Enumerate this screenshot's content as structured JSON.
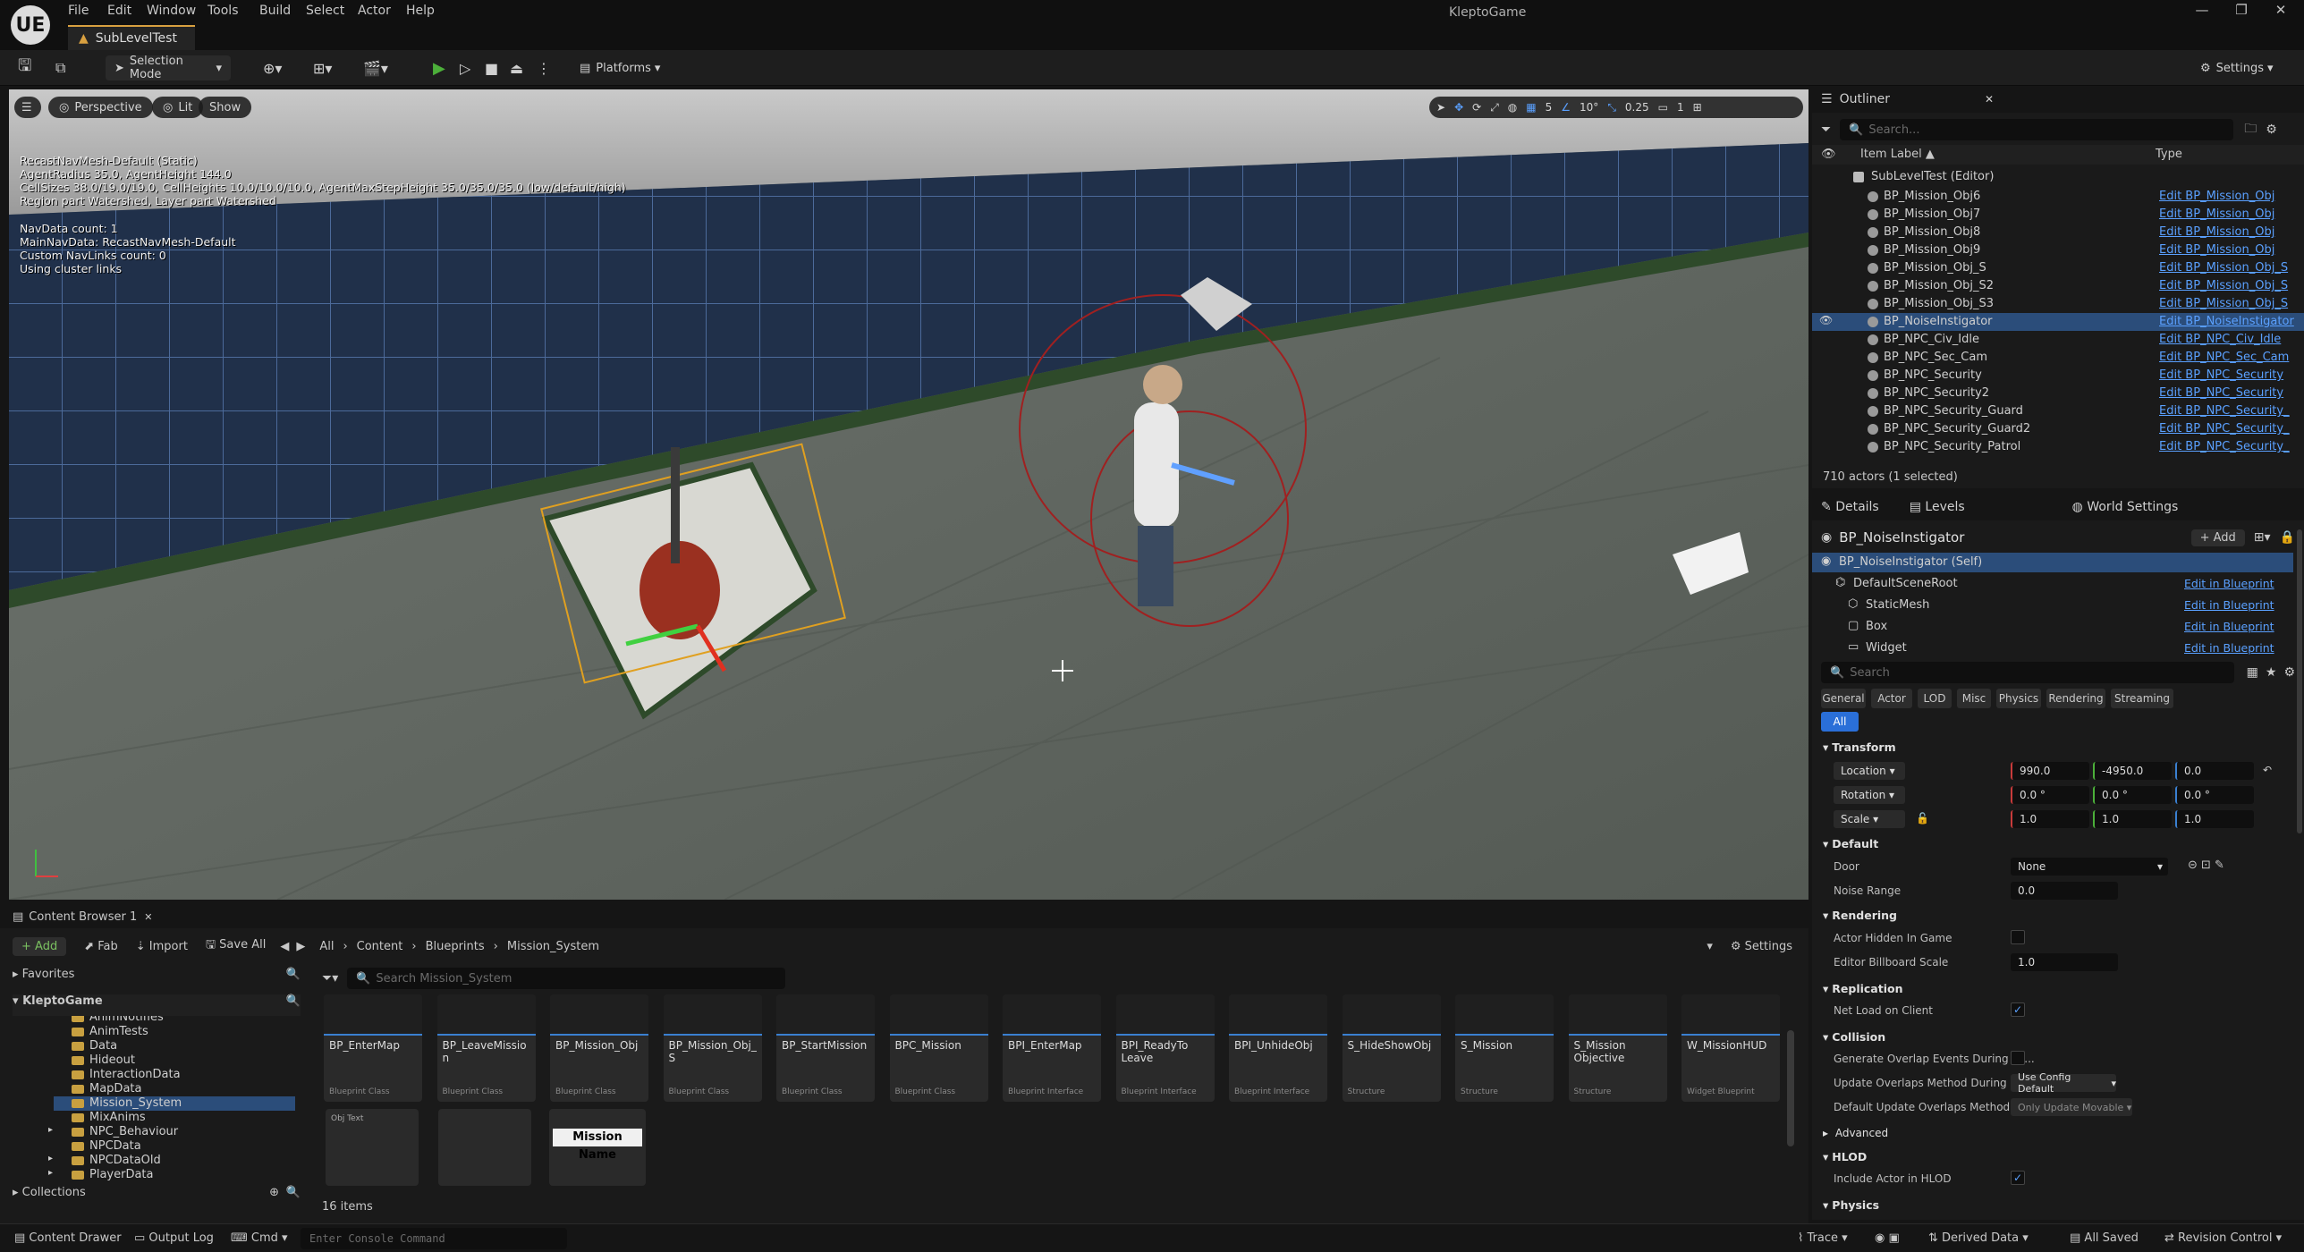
{
  "app": {
    "project": "KleptoGame",
    "tab": "SubLevelTest",
    "logo": "UE"
  },
  "menu": [
    "File",
    "Edit",
    "Window",
    "Tools",
    "Build",
    "Select",
    "Actor",
    "Help"
  ],
  "window_controls": {
    "minimize": "—",
    "maximize": "❐",
    "close": "✕"
  },
  "toolbar": {
    "mode": "Selection Mode",
    "platforms": "Platforms",
    "settings": "Settings"
  },
  "viewport": {
    "hamburger": "☰",
    "perspective": "Perspective",
    "lit": "Lit",
    "show": "Show",
    "snap_grid": "5",
    "snap_angle": "10°",
    "snap_scale": "0.25",
    "camera_speed": "1",
    "debug_lines": [
      "RecastNavMesh-Default (Static)",
      "AgentRadius 35.0, AgentHeight 144.0",
      "CellSizes 38.0/19.0/19.0, CellHeights 10.0/10.0/10.0, AgentMaxStepHeight 35.0/35.0/35.0 (low/default/high)",
      "Region part Watershed, Layer part Watershed"
    ],
    "nav_lines": [
      "NavData count: 1",
      "MainNavData: RecastNavMesh-Default",
      "Custom NavLinks count: 0",
      "Using cluster links"
    ]
  },
  "outliner": {
    "title": "Outliner",
    "search_placeholder": "Search...",
    "col_label": "Item Label ▲",
    "col_type": "Type",
    "root": "SubLevelTest (Editor)",
    "rows": [
      {
        "name": "BP_Mission_Obj6",
        "type": "Edit BP_Mission_Obj"
      },
      {
        "name": "BP_Mission_Obj7",
        "type": "Edit BP_Mission_Obj"
      },
      {
        "name": "BP_Mission_Obj8",
        "type": "Edit BP_Mission_Obj"
      },
      {
        "name": "BP_Mission_Obj9",
        "type": "Edit BP_Mission_Obj"
      },
      {
        "name": "BP_Mission_Obj_S",
        "type": "Edit BP_Mission_Obj_S"
      },
      {
        "name": "BP_Mission_Obj_S2",
        "type": "Edit BP_Mission_Obj_S"
      },
      {
        "name": "BP_Mission_Obj_S3",
        "type": "Edit BP_Mission_Obj_S"
      },
      {
        "name": "BP_NoiseInstigator",
        "type": "Edit BP_NoiseInstigator"
      },
      {
        "name": "BP_NPC_Civ_Idle",
        "type": "Edit BP_NPC_Civ_Idle"
      },
      {
        "name": "BP_NPC_Sec_Cam",
        "type": "Edit BP_NPC_Sec_Cam"
      },
      {
        "name": "BP_NPC_Security",
        "type": "Edit BP_NPC_Security"
      },
      {
        "name": "BP_NPC_Security2",
        "type": "Edit BP_NPC_Security"
      },
      {
        "name": "BP_NPC_Security_Guard",
        "type": "Edit BP_NPC_Security_"
      },
      {
        "name": "BP_NPC_Security_Guard2",
        "type": "Edit BP_NPC_Security_"
      },
      {
        "name": "BP_NPC_Security_Patrol",
        "type": "Edit BP_NPC_Security_"
      }
    ],
    "count": "710 actors (1 selected)"
  },
  "details": {
    "tab_details": "Details",
    "tab_levels": "Levels",
    "tab_world": "World Settings",
    "actor": "BP_NoiseInstigator",
    "add": "+ Add",
    "components": [
      {
        "name": "BP_NoiseInstigator (Self)",
        "link": ""
      },
      {
        "name": "DefaultSceneRoot",
        "link": "Edit in Blueprint"
      },
      {
        "name": "StaticMesh",
        "link": "Edit in Blueprint"
      },
      {
        "name": "Box",
        "link": "Edit in Blueprint"
      },
      {
        "name": "Widget",
        "link": "Edit in Blueprint"
      }
    ],
    "search_placeholder": "Search",
    "categories": [
      "General",
      "Actor",
      "LOD",
      "Misc",
      "Physics",
      "Rendering",
      "Streaming"
    ],
    "all": "All",
    "transform": {
      "title": "Transform",
      "location_label": "Location",
      "rotation_label": "Rotation",
      "scale_label": "Scale",
      "location": [
        "990.0",
        "-4950.0",
        "0.0"
      ],
      "rotation": [
        "0.0 °",
        "0.0 °",
        "0.0 °"
      ],
      "scale": [
        "1.0",
        "1.0",
        "1.0"
      ]
    },
    "default": {
      "title": "Default",
      "door_label": "Door",
      "door_value": "None",
      "noise_label": "Noise Range",
      "noise_value": "0.0"
    },
    "rendering": {
      "title": "Rendering",
      "hidden_label": "Actor Hidden In Game",
      "billboard_label": "Editor Billboard Scale",
      "billboard_value": "1.0"
    },
    "replication": {
      "title": "Replication",
      "net_load_label": "Net Load on Client"
    },
    "collision": {
      "title": "Collision",
      "gen_overlap_label": "Generate Overlap Events During Le...",
      "update_method_label": "Update Overlaps Method During Le...",
      "update_method_value": "Use Config Default",
      "default_update_label": "Default Update Overlaps Method D...",
      "default_update_value": "Only Update Movable"
    },
    "advanced": "Advanced",
    "hlod": {
      "title": "HLOD",
      "include_label": "Include Actor in HLOD"
    },
    "physics": "Physics"
  },
  "content_browser": {
    "tab": "Content Browser 1",
    "add": "+ Add",
    "fab": "Fab",
    "import": "Import",
    "save_all": "Save All",
    "path": [
      "All",
      "Content",
      "Blueprints",
      "Mission_System"
    ],
    "settings": "Settings",
    "favorites": "Favorites",
    "root": "KleptoGame",
    "folders": [
      "AnimNotifies",
      "AnimTests",
      "Data",
      "Hideout",
      "InteractionData",
      "MapData",
      "Mission_System",
      "MixAnims",
      "NPC_Behaviour",
      "NPCData",
      "NPCDataOld",
      "PlayerData"
    ],
    "collections": "Collections",
    "search_placeholder": "Search Mission_System",
    "assets": [
      {
        "name": "BP_EnterMap",
        "type": "Blueprint Class"
      },
      {
        "name": "BP_LeaveMission",
        "type": "Blueprint Class"
      },
      {
        "name": "BP_Mission_Obj",
        "type": "Blueprint Class"
      },
      {
        "name": "BP_Mission_Obj_S",
        "type": "Blueprint Class"
      },
      {
        "name": "BP_StartMission",
        "type": "Blueprint Class"
      },
      {
        "name": "BPC_Mission",
        "type": "Blueprint Class"
      },
      {
        "name": "BPI_EnterMap",
        "type": "Blueprint Interface"
      },
      {
        "name": "BPI_ReadyTo Leave",
        "type": "Blueprint Interface"
      },
      {
        "name": "BPI_UnhideObj",
        "type": "Blueprint Interface"
      },
      {
        "name": "S_HideShowObj",
        "type": "Structure"
      },
      {
        "name": "S_Mission",
        "type": "Structure"
      },
      {
        "name": "S_Mission Objective",
        "type": "Structure"
      },
      {
        "name": "W_MissionHUD",
        "type": "Widget Blueprint"
      }
    ],
    "row2_label": "Obj Text",
    "mission_name": "Mission Name",
    "items_count": "16 items"
  },
  "status": {
    "drawer": "Content Drawer",
    "output": "Output Log",
    "cmd": "Cmd",
    "console_placeholder": "Enter Console Command",
    "trace": "Trace",
    "derived": "Derived Data",
    "saved": "All Saved",
    "revision": "Revision Control"
  },
  "colors": {
    "accent": "#3a7fd0",
    "selection": "#2b4d7a",
    "link": "#5aa0ff",
    "play": "#4caf3a"
  }
}
